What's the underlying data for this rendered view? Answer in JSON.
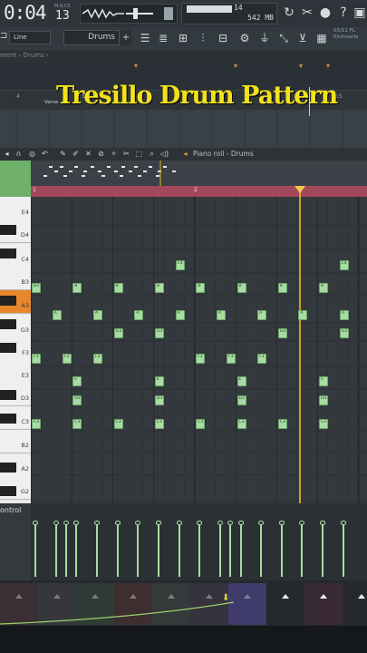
{
  "transport": {
    "time_main": "0:04",
    "time_sub": "13",
    "time_format_label": "M:S:CS",
    "cpu_value": "14",
    "memory": "542 MB",
    "polyphony": "3"
  },
  "toolbar2": {
    "snap_value": "Line",
    "pattern_name": "Drums",
    "pattern_add": "+",
    "news_line1": "05/11  FL",
    "news_line2": "Kilohearts"
  },
  "playlist": {
    "breadcrumb": "ment › Drums ›",
    "ruler_numbers": [
      "4",
      "5",
      "15"
    ],
    "clip_label": "Verse"
  },
  "caption": "Tresillo Drum Pattern",
  "piano_roll": {
    "title": "Piano roll - Drums",
    "ruler_labels": [
      "1",
      "2"
    ],
    "keys": [
      "E4",
      "D4",
      "C4",
      "B3",
      "A3",
      "G3",
      "F3",
      "E3",
      "D3",
      "C3",
      "B2",
      "A2",
      "G2"
    ],
    "notes": [
      {
        "label": "B3",
        "row": "B3",
        "col": 0
      },
      {
        "label": "B",
        "row": "B3",
        "col": 1
      },
      {
        "label": "B",
        "row": "B3",
        "col": 2
      },
      {
        "label": "B",
        "row": "B3",
        "col": 3
      },
      {
        "label": "B",
        "row": "B3",
        "col": 4
      },
      {
        "label": "B",
        "row": "B3",
        "col": 5
      },
      {
        "label": "B",
        "row": "B3",
        "col": 6
      },
      {
        "label": "B",
        "row": "B3",
        "col": 7
      },
      {
        "label": "C4",
        "row": "C4",
        "col": 3.5
      },
      {
        "label": "C4",
        "row": "C4",
        "col": 7.5
      },
      {
        "label": "A",
        "row": "A3",
        "col": 0.5
      },
      {
        "label": "A",
        "row": "A3",
        "col": 1.5
      },
      {
        "label": "A",
        "row": "A3",
        "col": 2.5
      },
      {
        "label": "A",
        "row": "A3",
        "col": 3.5
      },
      {
        "label": "A",
        "row": "A3",
        "col": 4.5
      },
      {
        "label": "A",
        "row": "A3",
        "col": 5.5
      },
      {
        "label": "A",
        "row": "A3",
        "col": 6.5
      },
      {
        "label": "A",
        "row": "A3",
        "col": 7.5
      },
      {
        "label": "G3",
        "row": "G3",
        "col": 2
      },
      {
        "label": "G3",
        "row": "G3",
        "col": 3
      },
      {
        "label": "G3",
        "row": "G3",
        "col": 6
      },
      {
        "label": "G3",
        "row": "G3",
        "col": 7.5
      },
      {
        "label": "F3",
        "row": "F3",
        "col": 0
      },
      {
        "label": "F3",
        "row": "F3",
        "col": 0.75
      },
      {
        "label": "F3",
        "row": "F3",
        "col": 1.5
      },
      {
        "label": "F3",
        "row": "F3",
        "col": 4
      },
      {
        "label": "F3",
        "row": "F3",
        "col": 4.75
      },
      {
        "label": "F3",
        "row": "F3",
        "col": 5.5
      },
      {
        "label": "E",
        "row": "E3",
        "col": 1
      },
      {
        "label": "E",
        "row": "E3",
        "col": 3
      },
      {
        "label": "E",
        "row": "E3",
        "col": 5
      },
      {
        "label": "E",
        "row": "E3",
        "col": 7
      },
      {
        "label": "D3",
        "row": "D3",
        "col": 1
      },
      {
        "label": "D3",
        "row": "D3",
        "col": 3
      },
      {
        "label": "D3",
        "row": "D3",
        "col": 5
      },
      {
        "label": "D3",
        "row": "D3",
        "col": 7
      },
      {
        "label": "C3",
        "row": "C3",
        "col": 0
      },
      {
        "label": "C3",
        "row": "C3",
        "col": 1
      },
      {
        "label": "C3",
        "row": "C3",
        "col": 2
      },
      {
        "label": "C3",
        "row": "C3",
        "col": 3
      },
      {
        "label": "C3",
        "row": "C3",
        "col": 4
      },
      {
        "label": "C3",
        "row": "C3",
        "col": 5
      },
      {
        "label": "C3",
        "row": "C3",
        "col": 6
      },
      {
        "label": "C3",
        "row": "C3",
        "col": 7
      }
    ]
  },
  "control_lane": {
    "label": "ontrol"
  },
  "bottom_channels": [
    {
      "color": "#3a2f34"
    },
    {
      "color": "#36373d"
    },
    {
      "color": "#2f3b35"
    },
    {
      "color": "#3d2f30"
    },
    {
      "color": "#34393a"
    },
    {
      "color": "#37333e"
    },
    {
      "color": "#3f3b6a"
    },
    {
      "color": "#25292c"
    },
    {
      "color": "#3a2a36"
    },
    {
      "color": "#25292c"
    }
  ]
}
